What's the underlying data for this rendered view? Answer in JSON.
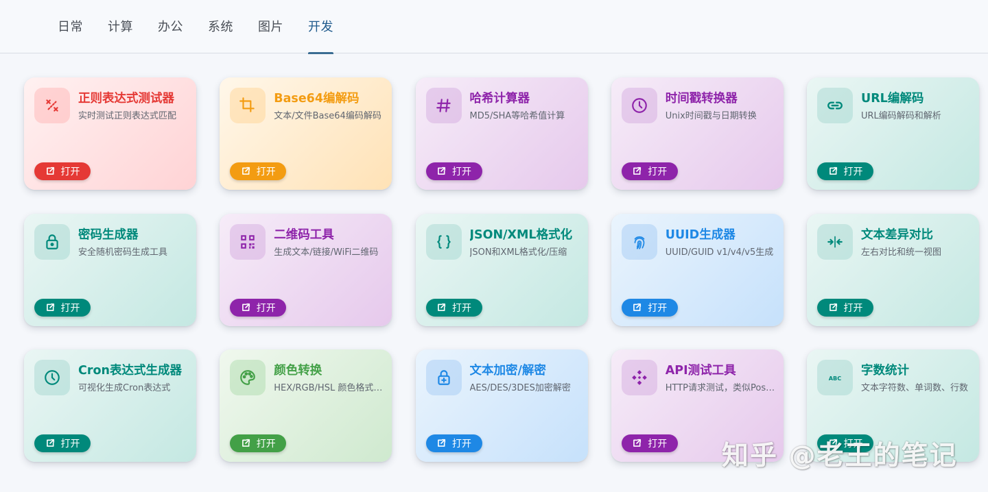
{
  "tabs": [
    "日常",
    "计算",
    "办公",
    "系统",
    "图片",
    "开发"
  ],
  "active_tab": "开发",
  "open_label": "打开",
  "cards": [
    {
      "title": "正则表达式测试器",
      "desc": "实时测试正则表达式匹配",
      "icon": "regex-icon",
      "accent": "#e53935",
      "theme": "red"
    },
    {
      "title": "Base64编解码",
      "desc": "文本/文件Base64编码解码",
      "icon": "crop-icon",
      "accent": "#f39c12",
      "theme": "orange"
    },
    {
      "title": "哈希计算器",
      "desc": "MD5/SHA等哈希值计算",
      "icon": "hash-icon",
      "accent": "#8e24aa",
      "theme": "purple"
    },
    {
      "title": "时间戳转换器",
      "desc": "Unix时间戳与日期转换",
      "icon": "clock-icon",
      "accent": "#8e24aa",
      "theme": "purple"
    },
    {
      "title": "URL编解码",
      "desc": "URL编码解码和解析",
      "icon": "link-icon",
      "accent": "#00897b",
      "theme": "teal"
    },
    {
      "title": "密码生成器",
      "desc": "安全随机密码生成工具",
      "icon": "lock-icon",
      "accent": "#00897b",
      "theme": "teal"
    },
    {
      "title": "二维码工具",
      "desc": "生成文本/链接/WiFi二维码",
      "icon": "qrcode-icon",
      "accent": "#8e24aa",
      "theme": "purple"
    },
    {
      "title": "JSON/XML格式化",
      "desc": "JSON和XML格式化/压缩",
      "icon": "braces-icon",
      "accent": "#00897b",
      "theme": "teal"
    },
    {
      "title": "UUID生成器",
      "desc": "UUID/GUID v1/v4/v5生成",
      "icon": "fingerprint-icon",
      "accent": "#1e88e5",
      "theme": "blue"
    },
    {
      "title": "文本差异对比",
      "desc": "左右对比和统一视图",
      "icon": "compare-icon",
      "accent": "#00897b",
      "theme": "teal"
    },
    {
      "title": "Cron表达式生成器",
      "desc": "可视化生成Cron表达式",
      "icon": "clock-icon",
      "accent": "#00897b",
      "theme": "teal"
    },
    {
      "title": "颜色转换",
      "desc": "HEX/RGB/HSL 颜色格式转换",
      "icon": "palette-icon",
      "accent": "#43a047",
      "theme": "green"
    },
    {
      "title": "文本加密/解密",
      "desc": "AES/DES/3DES加密解密",
      "icon": "lock-plus-icon",
      "accent": "#1e88e5",
      "theme": "blue"
    },
    {
      "title": "API测试工具",
      "desc": "HTTP请求测试，类似Postman",
      "icon": "api-icon",
      "accent": "#8e24aa",
      "theme": "purple"
    },
    {
      "title": "字数统计",
      "desc": "文本字符数、单词数、行数",
      "icon": "abc-icon",
      "accent": "#00897b",
      "theme": "teal"
    }
  ],
  "watermark": "知乎 @老王的笔记"
}
